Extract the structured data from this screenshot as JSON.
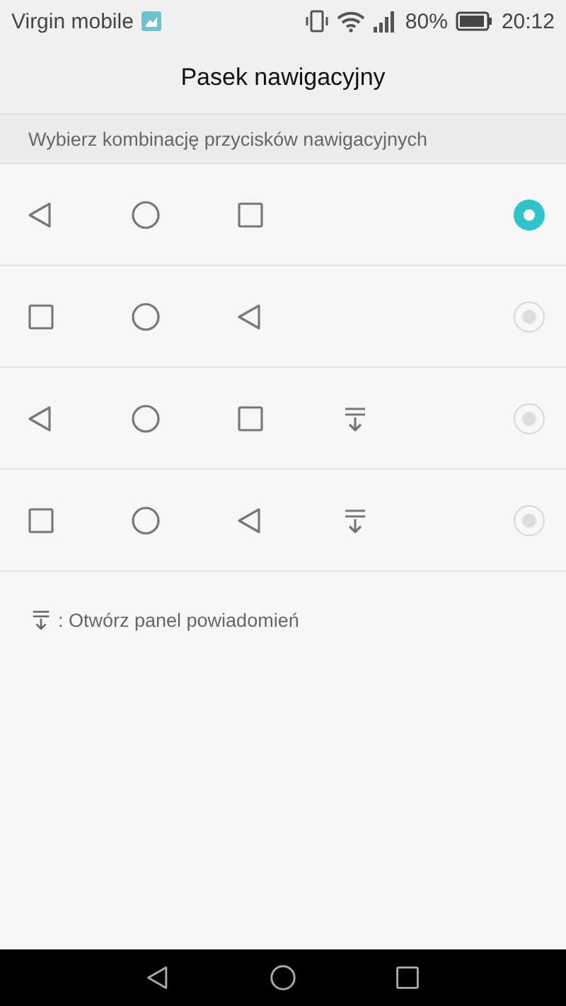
{
  "status_bar": {
    "carrier": "Virgin mobile",
    "battery_percent": "80%",
    "time": "20:12"
  },
  "title": "Pasek nawigacyjny",
  "section_header": "Wybierz kombinację przycisków nawigacyjnych",
  "options": [
    {
      "buttons": [
        {
          "kind": "back"
        },
        {
          "kind": "home"
        },
        {
          "kind": "recent"
        }
      ],
      "selected": true
    },
    {
      "buttons": [
        {
          "kind": "recent"
        },
        {
          "kind": "home"
        },
        {
          "kind": "back"
        }
      ],
      "selected": false
    },
    {
      "buttons": [
        {
          "kind": "back"
        },
        {
          "kind": "home"
        },
        {
          "kind": "recent"
        },
        {
          "kind": "notify"
        }
      ],
      "selected": false
    },
    {
      "buttons": [
        {
          "kind": "recent"
        },
        {
          "kind": "home"
        },
        {
          "kind": "back"
        },
        {
          "kind": "notify"
        }
      ],
      "selected": false
    }
  ],
  "legend": ": Otwórz panel powiadomień",
  "nav_bar": [
    {
      "kind": "back"
    },
    {
      "kind": "home"
    },
    {
      "kind": "recent"
    }
  ]
}
